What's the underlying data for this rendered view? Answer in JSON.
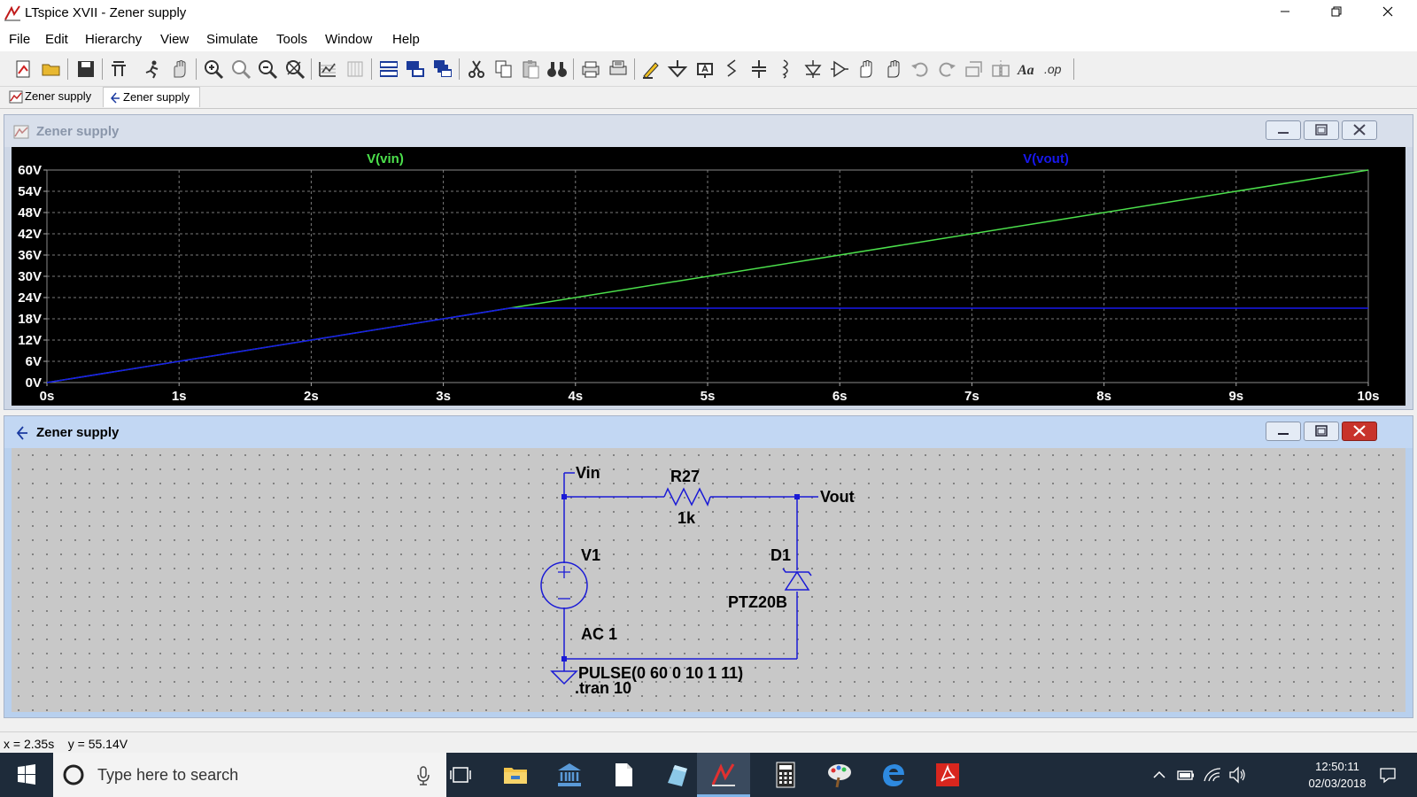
{
  "window": {
    "title": "LTspice XVII - Zener supply"
  },
  "menu": [
    "File",
    "Edit",
    "Hierarchy",
    "View",
    "Simulate",
    "Tools",
    "Window",
    "Help"
  ],
  "tabs": [
    {
      "label": "Zener supply",
      "icon": "waveform-icon"
    },
    {
      "label": "Zener supply",
      "icon": "schematic-icon"
    }
  ],
  "waveform_pane": {
    "title": "Zener supply"
  },
  "schematic_pane": {
    "title": "Zener supply"
  },
  "chart_data": {
    "type": "line",
    "x_unit": "s",
    "y_unit": "V",
    "xlim": [
      0,
      10
    ],
    "ylim": [
      0,
      60
    ],
    "x_ticks": [
      "0s",
      "1s",
      "2s",
      "3s",
      "4s",
      "5s",
      "6s",
      "7s",
      "8s",
      "9s",
      "10s"
    ],
    "y_ticks": [
      "0V",
      "6V",
      "12V",
      "18V",
      "24V",
      "30V",
      "36V",
      "42V",
      "48V",
      "54V",
      "60V"
    ],
    "grid": true,
    "background": "#000000",
    "series": [
      {
        "name": "V(vin)",
        "color": "#4ce04c",
        "x": [
          0,
          10
        ],
        "y": [
          0,
          60
        ]
      },
      {
        "name": "V(vout)",
        "color": "#1818ee",
        "x": [
          0,
          3.5,
          10
        ],
        "y": [
          0,
          21,
          21
        ]
      }
    ]
  },
  "schematic": {
    "wire_color": "#1a1ad6",
    "labels": {
      "vin": "Vin",
      "vout": "Vout",
      "r_name": "R27",
      "r_value": "1k",
      "v_name": "V1",
      "v_value": "AC 1",
      "d_name": "D1",
      "d_model": "PTZ20B",
      "pulse": "PULSE(0 60 0 10 1 11)",
      "tran": ".tran 10"
    }
  },
  "status": {
    "cursor": "x = 2.35s    y = 55.14V"
  },
  "taskbar": {
    "search_placeholder": "Type here to search",
    "time": "12:50:11",
    "date": "02/03/2018"
  }
}
